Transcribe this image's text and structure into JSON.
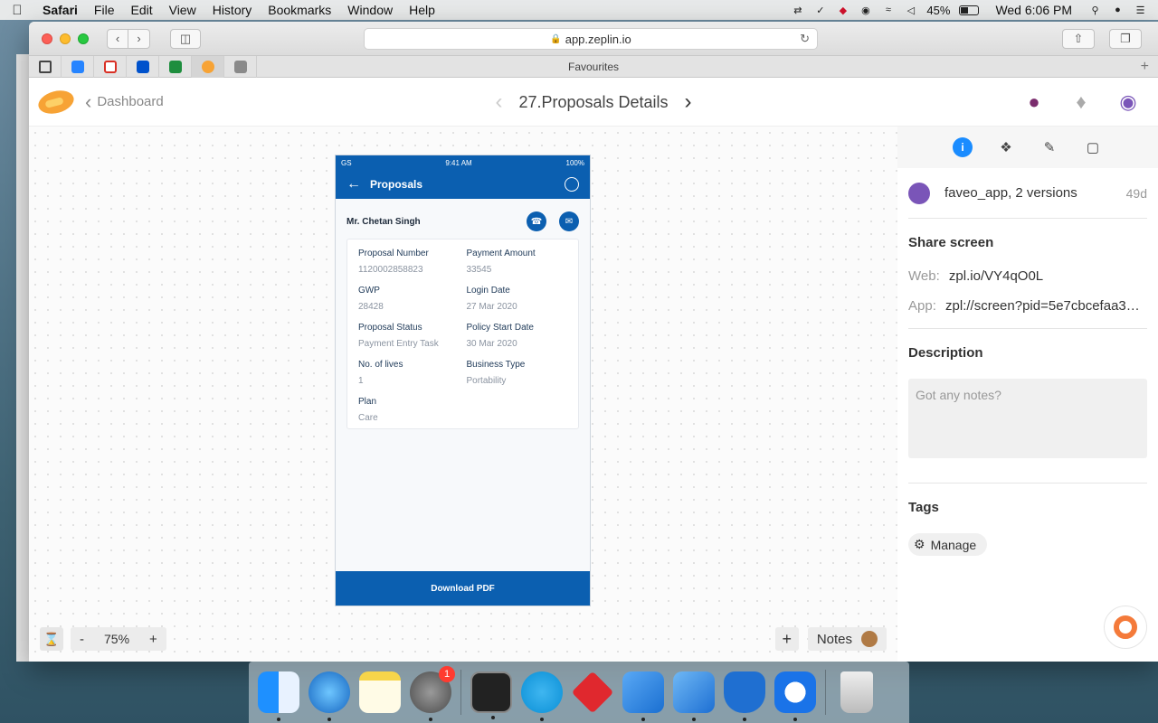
{
  "menubar": {
    "app_name": "Safari",
    "items": [
      "File",
      "Edit",
      "View",
      "History",
      "Bookmarks",
      "Window",
      "Help"
    ],
    "battery": "45%",
    "clock": "Wed 6:06 PM"
  },
  "browser": {
    "url": "app.zeplin.io",
    "favourites_label": "Favourites"
  },
  "zeplin": {
    "back_label": "Dashboard",
    "screen_title": "27.Proposals Details"
  },
  "phone": {
    "status_carrier": "GS",
    "status_time": "9:41 AM",
    "status_battery": "100%",
    "nav_title": "Proposals",
    "customer_name": "Mr. Chetan Singh",
    "fields": [
      {
        "label": "Proposal Number",
        "value": "1120002858823"
      },
      {
        "label": "Payment Amount",
        "value": "33545"
      },
      {
        "label": "GWP",
        "value": "28428"
      },
      {
        "label": "Login Date",
        "value": "27 Mar 2020"
      },
      {
        "label": "Proposal Status",
        "value": "Payment Entry Task"
      },
      {
        "label": "Policy Start Date",
        "value": "30 Mar 2020"
      },
      {
        "label": "No. of lives",
        "value": "1"
      },
      {
        "label": "Business Type",
        "value": "Portability"
      },
      {
        "label": "Plan",
        "value": "Care"
      }
    ],
    "download_label": "Download PDF"
  },
  "canvas": {
    "zoom": "75%",
    "zoom_minus": "-",
    "zoom_plus": "+",
    "notes_label": "Notes",
    "add_label": "+"
  },
  "panel": {
    "owner": "faveo_app, 2 versions",
    "age": "49d",
    "share_title": "Share screen",
    "web_label": "Web:",
    "web_link": "zpl.io/VY4qO0L",
    "app_label": "App:",
    "app_link": "zpl://screen?pid=5e7cbcefaa3…",
    "description_title": "Description",
    "notes_placeholder": "Got any notes?",
    "tags_title": "Tags",
    "manage_label": "Manage"
  },
  "dock": {
    "system_prefs_badge": "1"
  },
  "colors": {
    "brand_blue": "#0b5fb0",
    "info_blue": "#1a8cff",
    "zeplin_orange": "#f7a335"
  }
}
